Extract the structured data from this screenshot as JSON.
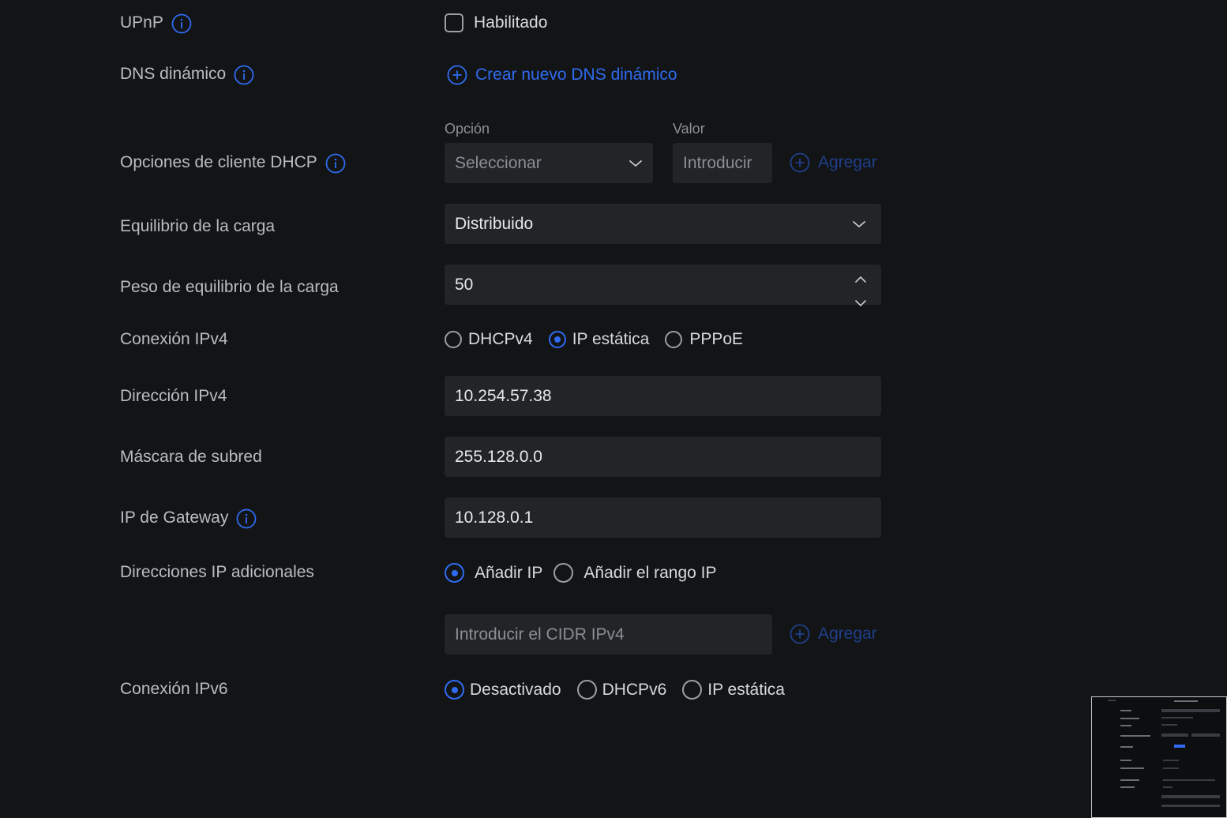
{
  "upnp": {
    "label": "UPnP",
    "checkbox_label": "Habilitado",
    "checked": false
  },
  "ddns": {
    "label": "DNS dinámico",
    "create_link": "Crear nuevo DNS dinámico"
  },
  "dhcp_client_options": {
    "label": "Opciones de cliente DHCP",
    "option_header": "Opción",
    "value_header": "Valor",
    "option_select": "Seleccionar",
    "value_placeholder": "Introducir",
    "add_label": "Agregar"
  },
  "load_balance": {
    "label": "Equilibrio de la carga",
    "value": "Distribuido"
  },
  "load_balance_weight": {
    "label": "Peso de equilibrio de la carga",
    "value": "50"
  },
  "ipv4_connection": {
    "label": "Conexión IPv4",
    "options": [
      "DHCPv4",
      "IP estática",
      "PPPoE"
    ],
    "selected": "IP estática"
  },
  "ipv4_address": {
    "label": "Dirección IPv4",
    "value": "10.254.57.38"
  },
  "subnet_mask": {
    "label": "Máscara de subred",
    "value": "255.128.0.0"
  },
  "gateway_ip": {
    "label": "IP de Gateway",
    "value": "10.128.0.1"
  },
  "additional_ips": {
    "label": "Direcciones IP adicionales",
    "options": [
      "Añadir IP",
      "Añadir el rango IP"
    ],
    "selected": "Añadir IP",
    "cidr_placeholder": "Introducir el CIDR IPv4",
    "add_label": "Agregar"
  },
  "ipv6_connection": {
    "label": "Conexión IPv6",
    "options": [
      "Desactivado",
      "DHCPv6",
      "IP estática"
    ],
    "selected": "Desactivado"
  },
  "colors": {
    "background": "#131416",
    "field": "#232427",
    "accent": "#2f6bf0",
    "label": "#b9bcc2"
  }
}
